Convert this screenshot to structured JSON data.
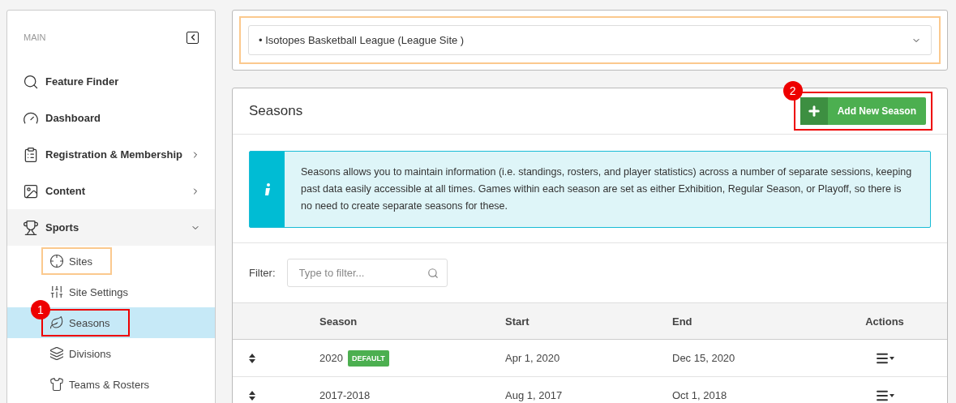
{
  "sidebar": {
    "section_label": "MAIN",
    "items": [
      {
        "label": "Feature Finder",
        "has_arrow": false
      },
      {
        "label": "Dashboard",
        "has_arrow": false
      },
      {
        "label": "Registration & Membership",
        "has_arrow": true,
        "expanded": false
      },
      {
        "label": "Content",
        "has_arrow": true,
        "expanded": false
      },
      {
        "label": "Sports",
        "has_arrow": true,
        "expanded": true,
        "children": [
          {
            "label": "Sites",
            "selected": false,
            "outlined": true,
            "color": "#fbc98e"
          },
          {
            "label": "Site Settings",
            "selected": false,
            "outlined": false
          },
          {
            "label": "Seasons",
            "selected": true,
            "outlined": true,
            "color": "#ee0000",
            "badge": "1"
          },
          {
            "label": "Divisions",
            "selected": false,
            "outlined": false
          },
          {
            "label": "Teams & Rosters",
            "selected": false,
            "outlined": false
          }
        ]
      }
    ]
  },
  "site_selector": {
    "value": "• Isotopes Basketball League (League Site )",
    "outlined": true,
    "color": "#fbc98e"
  },
  "seasons_panel": {
    "title": "Seasons",
    "add_button": {
      "label": "Add New Season",
      "outlined": true,
      "color": "#ee0000",
      "badge": "2"
    },
    "info": "Seasons allows you to maintain information (i.e. standings, rosters, and player statistics) across a number of separate sessions, keeping past data easily accessible at all times. Games within each season are set as either Exhibition, Regular Season, or Playoff, so there is no need to create separate seasons for these.",
    "filter": {
      "label": "Filter:",
      "placeholder": "Type to filter..."
    },
    "table": {
      "columns": [
        "Season",
        "Start",
        "End",
        "Actions"
      ],
      "rows": [
        {
          "season": "2020",
          "default_tag": "DEFAULT",
          "start": "Apr 1, 2020",
          "end": "Dec 15, 2020"
        },
        {
          "season": "2017-2018",
          "start": "Aug 1, 2017",
          "end": "Oct 1, 2018"
        }
      ]
    }
  }
}
